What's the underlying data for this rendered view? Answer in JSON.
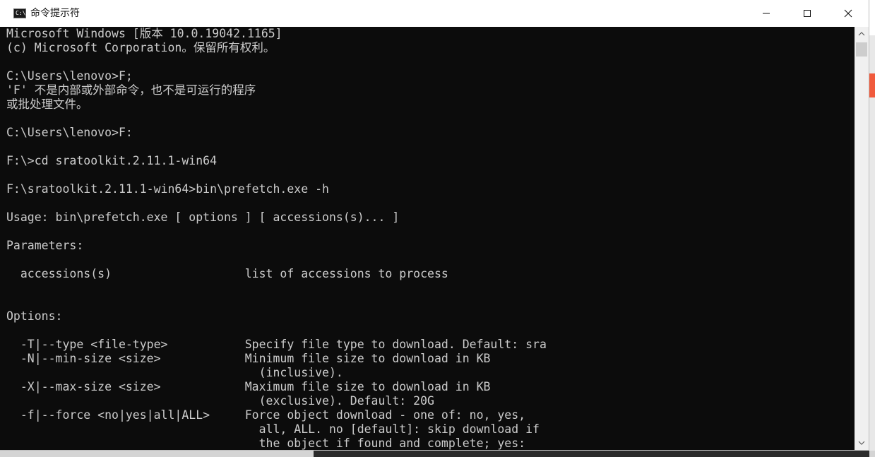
{
  "window": {
    "title": "命令提示符",
    "icon": "cmd-icon",
    "controls": {
      "minimize_icon": "minimize-icon",
      "maximize_icon": "maximize-icon",
      "close_icon": "close-icon"
    }
  },
  "console": {
    "lines": [
      "Microsoft Windows [版本 10.0.19042.1165]",
      "(c) Microsoft Corporation。保留所有权利。",
      "",
      "C:\\Users\\lenovo>F;",
      "'F' 不是内部或外部命令，也不是可运行的程序",
      "或批处理文件。",
      "",
      "C:\\Users\\lenovo>F:",
      "",
      "F:\\>cd sratoolkit.2.11.1-win64",
      "",
      "F:\\sratoolkit.2.11.1-win64>bin\\prefetch.exe -h",
      "",
      "Usage: bin\\prefetch.exe [ options ] [ accessions(s)... ]",
      "",
      "Parameters:",
      "",
      "  accessions(s)                   list of accessions to process",
      "",
      "",
      "Options:",
      "",
      "  -T|--type <file-type>           Specify file type to download. Default: sra",
      "  -N|--min-size <size>            Minimum file size to download in KB",
      "                                    (inclusive).",
      "  -X|--max-size <size>            Maximum file size to download in KB",
      "                                    (exclusive). Default: 20G",
      "  -f|--force <no|yes|all|ALL>     Force object download - one of: no, yes,",
      "                                    all, ALL. no [default]: skip download if",
      "                                    the object if found and complete; yes:"
    ],
    "colors": {
      "background": "#0c0c0c",
      "foreground": "#cccccc"
    }
  },
  "scrollbar": {
    "up_icon": "scroll-up-arrow-icon",
    "down_icon": "scroll-down-arrow-icon"
  }
}
